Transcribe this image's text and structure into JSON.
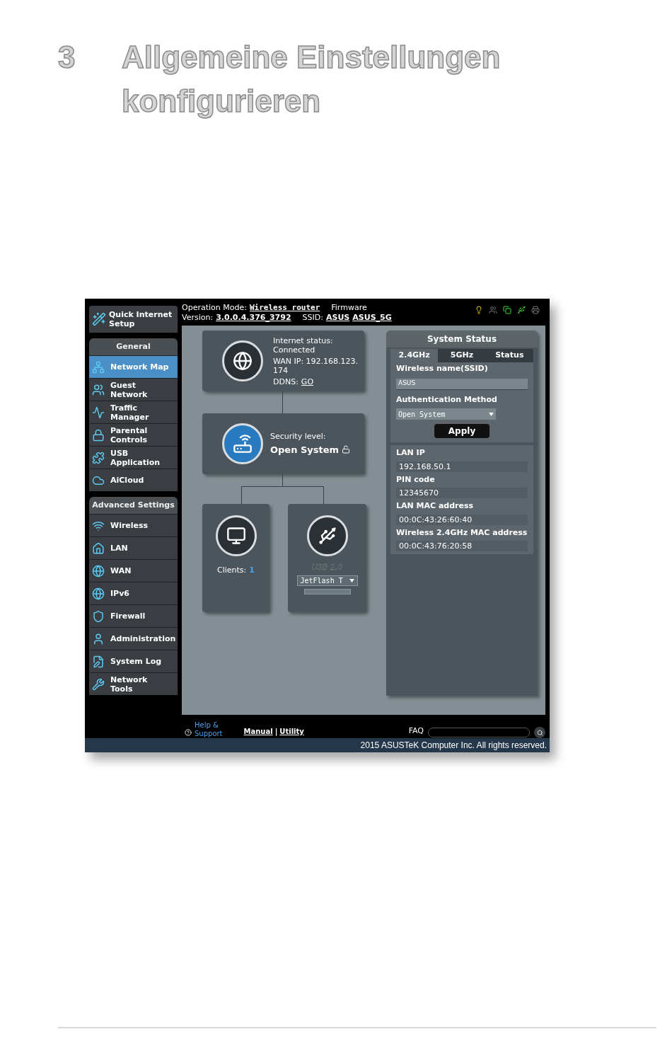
{
  "heading": {
    "number": "3",
    "title": "Allgemeine Einstellungen konfigurieren"
  },
  "header": {
    "operation_mode_label": "Operation Mode:",
    "operation_mode": "Wireless router",
    "firmware_label": "Firmware",
    "version_label": "Version:",
    "version": "3.0.0.4.376_3792",
    "ssid_label": "SSID:",
    "ssids": [
      "ASUS",
      "ASUS_5G"
    ]
  },
  "quick_setup": "Quick Internet\nSetup",
  "sidebar": [
    {
      "title": "General",
      "items": [
        {
          "label": "Network Map",
          "selected": true
        },
        {
          "label": "Guest\nNetwork",
          "selected": false
        },
        {
          "label": "Traffic\nManager",
          "selected": false
        },
        {
          "label": "Parental\nControls",
          "selected": false
        },
        {
          "label": "USB\nApplication",
          "selected": false
        },
        {
          "label": "AiCloud",
          "selected": false
        }
      ]
    },
    {
      "title": "Advanced Settings",
      "items": [
        {
          "label": "Wireless",
          "selected": false
        },
        {
          "label": "LAN",
          "selected": false
        },
        {
          "label": "WAN",
          "selected": false
        },
        {
          "label": "IPv6",
          "selected": false
        },
        {
          "label": "Firewall",
          "selected": false
        },
        {
          "label": "Administration",
          "selected": false
        },
        {
          "label": "System Log",
          "selected": false
        },
        {
          "label": "Network\nTools",
          "selected": false
        }
      ]
    }
  ],
  "network_map": {
    "internet": {
      "status_label": "Internet status:",
      "status": "Connected",
      "wan_ip_label": "WAN IP:",
      "wan_ip": "192.168.123.174",
      "ddns_label": "DDNS:",
      "ddns": "GO"
    },
    "security": {
      "label": "Security level:",
      "value": "Open System"
    },
    "clients": {
      "label": "Clients:",
      "count": "1"
    },
    "usb": {
      "label": "USB 2.0",
      "device": "JetFlash T"
    }
  },
  "system_status": {
    "title": "System Status",
    "tabs": [
      {
        "label": "2.4GHz",
        "selected": true
      },
      {
        "label": "5GHz",
        "selected": false
      },
      {
        "label": "Status",
        "selected": false
      }
    ],
    "ssid_label": "Wireless name(SSID)",
    "ssid": "ASUS",
    "auth_label": "Authentication Method",
    "auth": "Open System",
    "apply": "Apply",
    "info": [
      {
        "label": "LAN IP",
        "value": "192.168.50.1"
      },
      {
        "label": "PIN code",
        "value": "12345670"
      },
      {
        "label": "LAN MAC address",
        "value": "00:0C:43:26:60:40"
      },
      {
        "label": "Wireless 2.4GHz MAC address",
        "value": "00:0C:43:76:20:58"
      }
    ]
  },
  "footer": {
    "help": "Help &\nSupport",
    "manual": "Manual",
    "separator": "|",
    "utility": "Utility",
    "faq": "FAQ",
    "copyright": "2015 ASUSTeK Computer Inc. All rights reserved."
  }
}
